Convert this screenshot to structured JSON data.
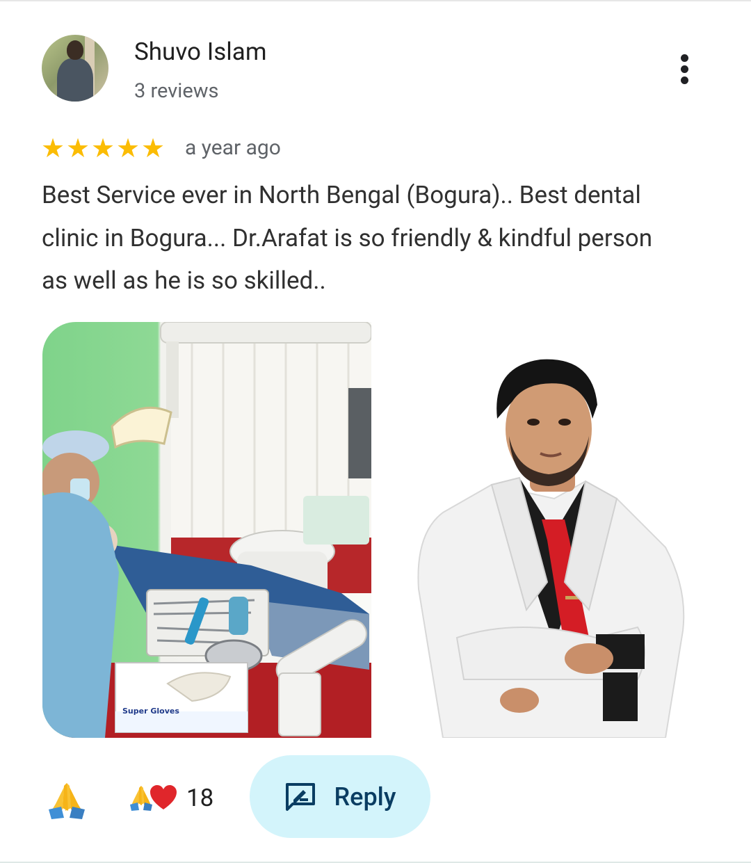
{
  "reviewer": {
    "name": "Shuvo Islam",
    "reviews": "3 reviews"
  },
  "review": {
    "rating": 5,
    "stars": [
      "★",
      "★",
      "★",
      "★",
      "★"
    ],
    "time": "a year ago",
    "text": "Best Service ever in North Bengal (Bogura).. Best dental clinic in Bogura... Dr.Arafat is so friendly & kindful person as well as he is so skilled.."
  },
  "photos": {
    "photo_1_text": "Super Gloves"
  },
  "reactions": {
    "count": "18"
  },
  "actions": {
    "reply_label": "Reply"
  },
  "colors": {
    "star": "#fbbc04",
    "reply_bg": "#d3f4fb",
    "reply_text": "#0a3d62"
  }
}
